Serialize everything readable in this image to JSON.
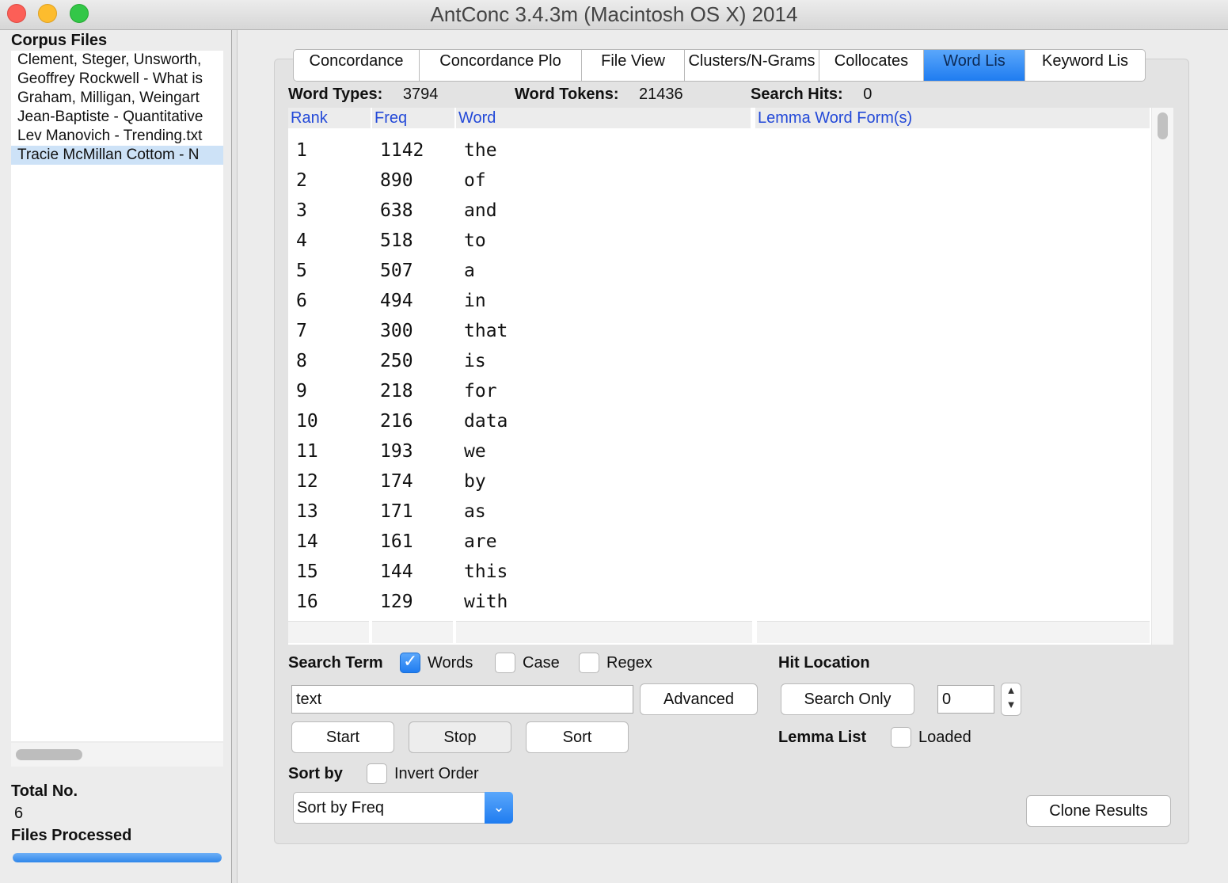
{
  "window": {
    "title": "AntConc 3.4.3m (Macintosh OS X) 2014"
  },
  "left_panel": {
    "corpus_files_label": "Corpus Files",
    "files": [
      "Clement, Steger, Unsworth,",
      "Geoffrey Rockwell - What is",
      "Graham, Milligan, Weingart",
      "Jean-Baptiste - Quantitative",
      "Lev Manovich - Trending.txt",
      "Tracie McMillan Cottom - N"
    ],
    "selected_file_index": 5,
    "total_label": "Total No.",
    "total_value": "6",
    "files_processed_label": "Files Processed",
    "progress_fraction": 1.0
  },
  "tabs": [
    {
      "label": "Concordance",
      "active": false
    },
    {
      "label": "Concordance Plo",
      "active": false
    },
    {
      "label": "File View",
      "active": false
    },
    {
      "label": "Clusters/N-Grams",
      "active": false
    },
    {
      "label": "Collocates",
      "active": false
    },
    {
      "label": "Word Lis",
      "active": true
    },
    {
      "label": "Keyword Lis",
      "active": false
    }
  ],
  "stats": {
    "word_types_label": "Word Types:",
    "word_types_value": "3794",
    "word_tokens_label": "Word Tokens:",
    "word_tokens_value": "21436",
    "search_hits_label": "Search Hits:",
    "search_hits_value": "0"
  },
  "table": {
    "columns": [
      "Rank",
      "Freq",
      "Word",
      "Lemma Word Form(s)"
    ],
    "rows": [
      [
        "1",
        "1142",
        "the"
      ],
      [
        "2",
        "890",
        "of"
      ],
      [
        "3",
        "638",
        "and"
      ],
      [
        "4",
        "518",
        "to"
      ],
      [
        "5",
        "507",
        "a"
      ],
      [
        "6",
        "494",
        "in"
      ],
      [
        "7",
        "300",
        "that"
      ],
      [
        "8",
        "250",
        "is"
      ],
      [
        "9",
        "218",
        "for"
      ],
      [
        "10",
        "216",
        "data"
      ],
      [
        "11",
        "193",
        "we"
      ],
      [
        "12",
        "174",
        "by"
      ],
      [
        "13",
        "171",
        "as"
      ],
      [
        "14",
        "161",
        "are"
      ],
      [
        "15",
        "144",
        "this"
      ],
      [
        "16",
        "129",
        "with"
      ]
    ]
  },
  "search": {
    "search_term_label": "Search Term",
    "words_label": "Words",
    "words_checked": true,
    "case_label": "Case",
    "case_checked": false,
    "regex_label": "Regex",
    "regex_checked": false,
    "input_value": "text",
    "advanced_label": "Advanced",
    "start_label": "Start",
    "stop_label": "Stop",
    "sort_label": "Sort"
  },
  "hit_location": {
    "label": "Hit Location",
    "search_only_label": "Search Only",
    "value": "0"
  },
  "lemma": {
    "label": "Lemma List",
    "loaded_label": "Loaded",
    "loaded_checked": false
  },
  "sort": {
    "sort_by_label": "Sort by",
    "invert_order_label": "Invert Order",
    "invert_checked": false,
    "selected_option": "Sort by Freq"
  },
  "clone_results_label": "Clone Results",
  "colors": {
    "accent_blue": "#1f7cf0",
    "header_text_blue": "#2349d8"
  }
}
